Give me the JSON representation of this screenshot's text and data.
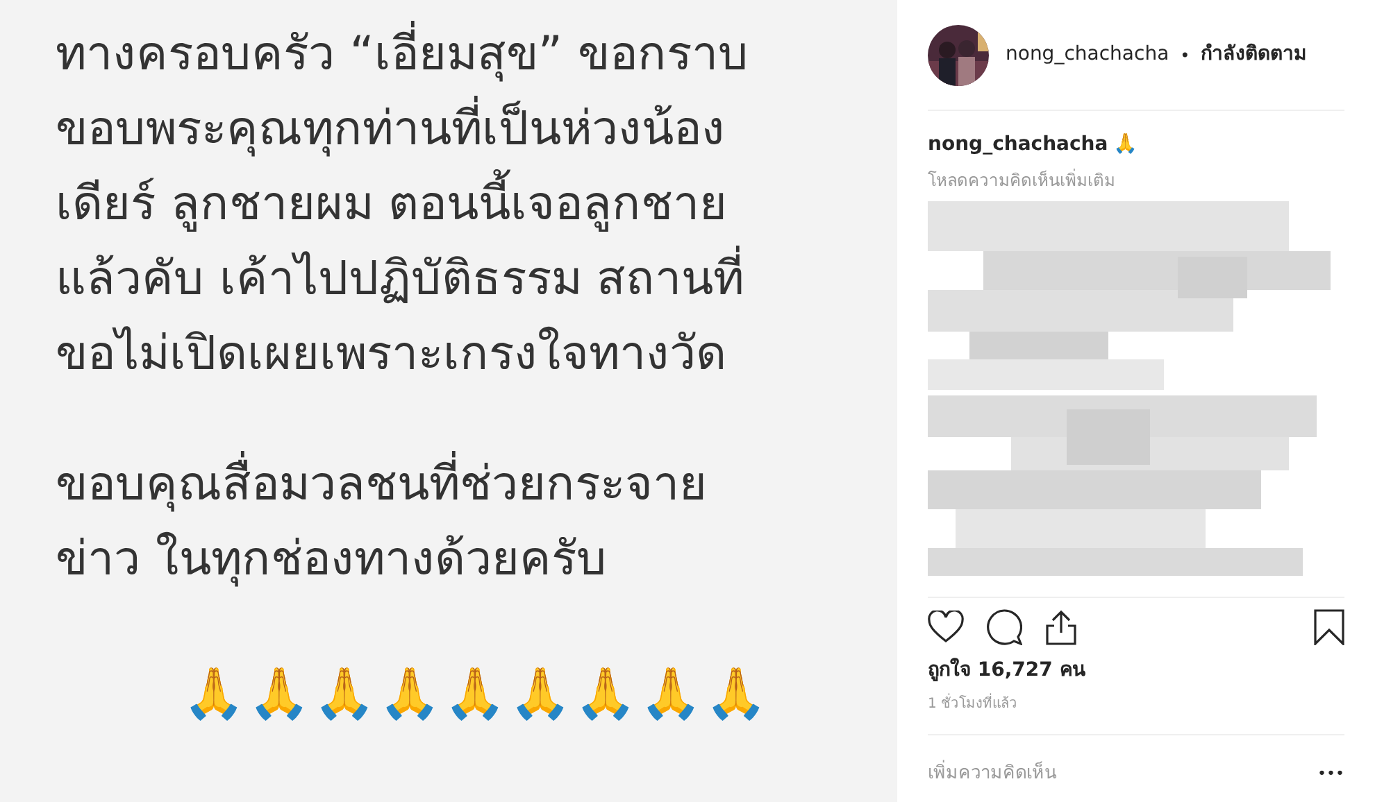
{
  "post_image": {
    "paragraphs": [
      [
        "ทางครอบครัว “เอี่ยมสุข” ขอกราบ",
        "ขอบพระคุณทุกท่านที่เป็นห่วงน้อง",
        "เดียร์ ลูกชายผม ตอนนี้เจอลูกชาย",
        "แล้วคับ เค้าไปปฏิบัติธรรม สถานที่",
        "ขอไม่เปิดเผยเพราะเกรงใจทางวัด"
      ],
      [
        "ขอบคุณสื่อมวลชนที่ช่วยกระจาย",
        "ข่าว ในทุกช่องทางด้วยครับ"
      ]
    ],
    "emojis": "🙏🙏🙏🙏🙏🙏🙏🙏🙏"
  },
  "header": {
    "username": "nong_chachacha",
    "separator": "•",
    "follow_status": "กำลังติดตาม"
  },
  "caption": {
    "username": "nong_chachacha",
    "text": "🙏"
  },
  "load_more": "โหลดความคิดเห็นเพิ่มเติม",
  "likes": "ถูกใจ 16,727 คน",
  "time": "1 ชั่วโมงที่แล้ว",
  "comment_placeholder": "เพิ่มความคิดเห็น",
  "more": "•••"
}
